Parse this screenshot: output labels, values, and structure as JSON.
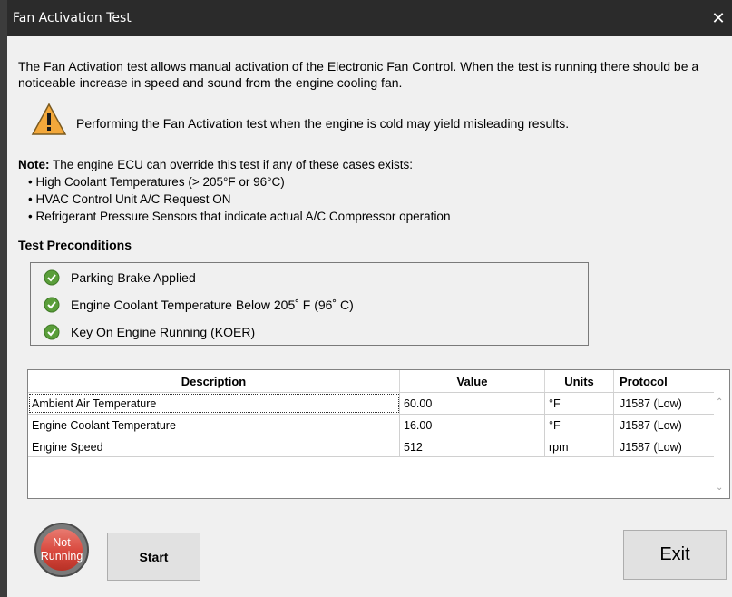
{
  "window": {
    "title": "Fan Activation Test",
    "close_glyph": "✕"
  },
  "intro": "The Fan Activation test allows manual activation of the Electronic Fan Control. When the test is running there should be a noticeable increase in speed and sound from the engine cooling fan.",
  "warning": {
    "icon": "warning-triangle-icon",
    "text": "Performing the Fan Activation test when the engine is cold may yield misleading results."
  },
  "note": {
    "label": "Note:",
    "text": " The engine ECU can override this test if any of these cases exists:",
    "bullets": [
      "• High Coolant Temperatures (> 205°F or 96°C)",
      "• HVAC Control Unit A/C Request ON",
      "• Refrigerant Pressure Sensors that indicate actual A/C Compressor operation"
    ]
  },
  "preconditions": {
    "heading": "Test Preconditions",
    "items": [
      {
        "label": "Parking Brake Applied",
        "icon": "check-circle-icon",
        "status_color": "#5a9e3a"
      },
      {
        "label": "Engine Coolant Temperature Below 205˚ F (96˚ C)",
        "icon": "check-circle-icon",
        "status_color": "#5a9e3a"
      },
      {
        "label": "Key On Engine Running (KOER)",
        "icon": "check-circle-icon",
        "status_color": "#5a9e3a"
      }
    ]
  },
  "table": {
    "headers": {
      "description": "Description",
      "value": "Value",
      "units": "Units",
      "protocol": "Protocol"
    },
    "rows": [
      {
        "description": "Ambient Air Temperature",
        "value": "60.00",
        "units": "°F",
        "protocol": "J1587 (Low)"
      },
      {
        "description": "Engine Coolant Temperature",
        "value": "16.00",
        "units": "°F",
        "protocol": "J1587 (Low)"
      },
      {
        "description": "Engine Speed",
        "value": "512",
        "units": "rpm",
        "protocol": "J1587 (Low)"
      }
    ]
  },
  "status": {
    "line1": "Not",
    "line2": "Running",
    "color": "#d8473c"
  },
  "buttons": {
    "start": "Start",
    "exit": "Exit"
  }
}
